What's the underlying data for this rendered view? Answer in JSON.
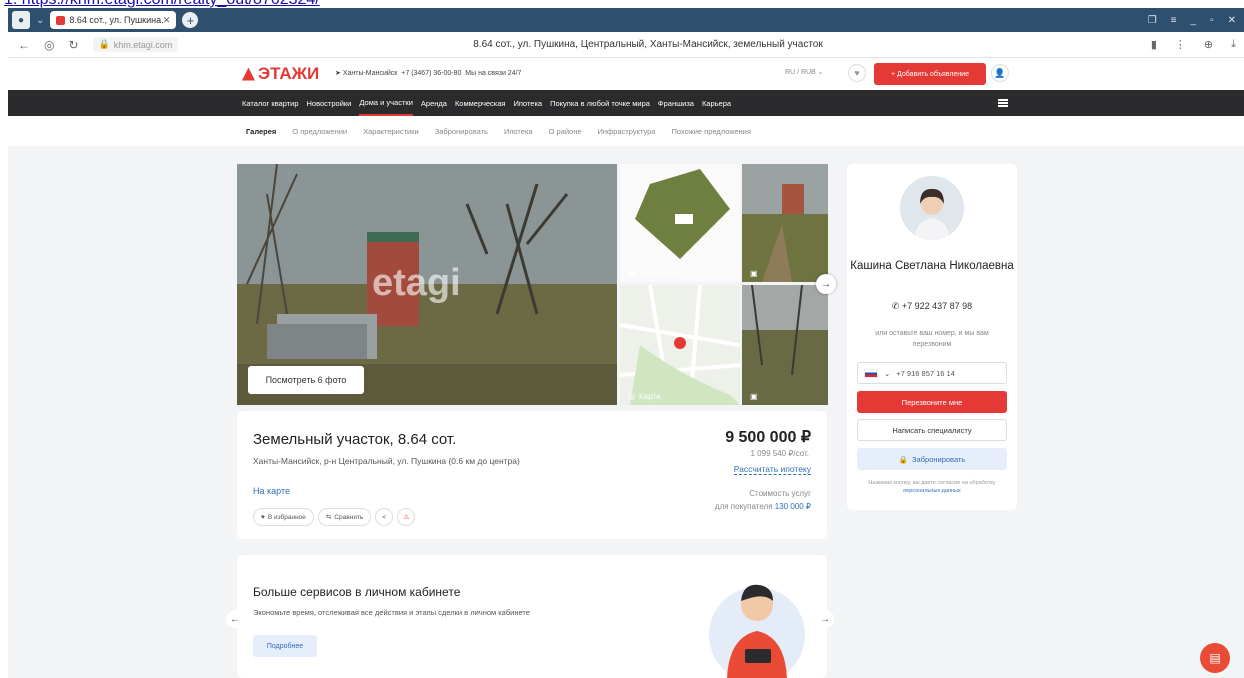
{
  "top_link": "1. https://khm.etagi.com/realty_out/8762324/",
  "browser": {
    "tab_title": "8.64 сот., ул. Пушкина...",
    "address": "khm.etagi.com",
    "page_title": "8.64 сот., ул. Пушкина, Центральный, Ханты-Мансийск, земельный участок"
  },
  "site": {
    "logo": "ЭТАЖИ",
    "city": "Ханты-Мансийск",
    "phone": "+7 (3467) 36-00-80",
    "phone_note": "Мы на связи 24/7",
    "lang": "RU / RUB",
    "add_label": "+ Добавить объявление"
  },
  "mainnav": [
    "Каталог квартир",
    "Новостройки",
    "Дома и участки",
    "Аренда",
    "Коммерческая",
    "Ипотека",
    "Покупка в любой точке мира",
    "Франшиза",
    "Карьера"
  ],
  "subnav": [
    "Галерея",
    "О предложении",
    "Характеристики",
    "Забронировать",
    "Ипотека",
    "О районе",
    "Инфраструктура",
    "Похожие предложения"
  ],
  "gallery": {
    "watermark": "etagi",
    "view_photos": "Посмотреть 6 фото",
    "plan_caption": "Планировка",
    "map_caption": "Карта"
  },
  "listing": {
    "title": "Земельный участок, 8.64 сот.",
    "address": "Ханты-Мансийск, р-н Центральный, ул. Пушкина (0.6 км до центра)",
    "on_map": "На карте",
    "fav": "В избранное",
    "compare": "Сравнить",
    "price": "9 500 000 ₽",
    "per_unit": "1 099 540 ₽/сот.",
    "mortgage": "Рассчитать ипотеку",
    "services_cost_1": "Стоимость услуг",
    "services_cost_2": "для покупателя",
    "services_cost_value": "130 000 ₽"
  },
  "services": {
    "title": "Больше сервисов в личном кабинете",
    "text": "Экономьте время, отслеживая все действия и этапы сделки в личном кабинете",
    "button": "Подробнее"
  },
  "agent": {
    "name": "Кашина Светлана Николаевна",
    "phone": "+7 922 437 87 98",
    "hint": "или оставьте ваш номер, и мы вам перезвоним",
    "input_value": "+7 916 857 16 14",
    "call_me": "Перезвоните мне",
    "write": "Написать специалисту",
    "book": "Забронировать",
    "legal_1": "Нажимая кнопку, вы даете согласие на обработку",
    "legal_2": "персональных данных"
  },
  "colors": {
    "brand": "#e53935",
    "link": "#2f6fbd",
    "nav_bg": "#2b2b2d"
  }
}
